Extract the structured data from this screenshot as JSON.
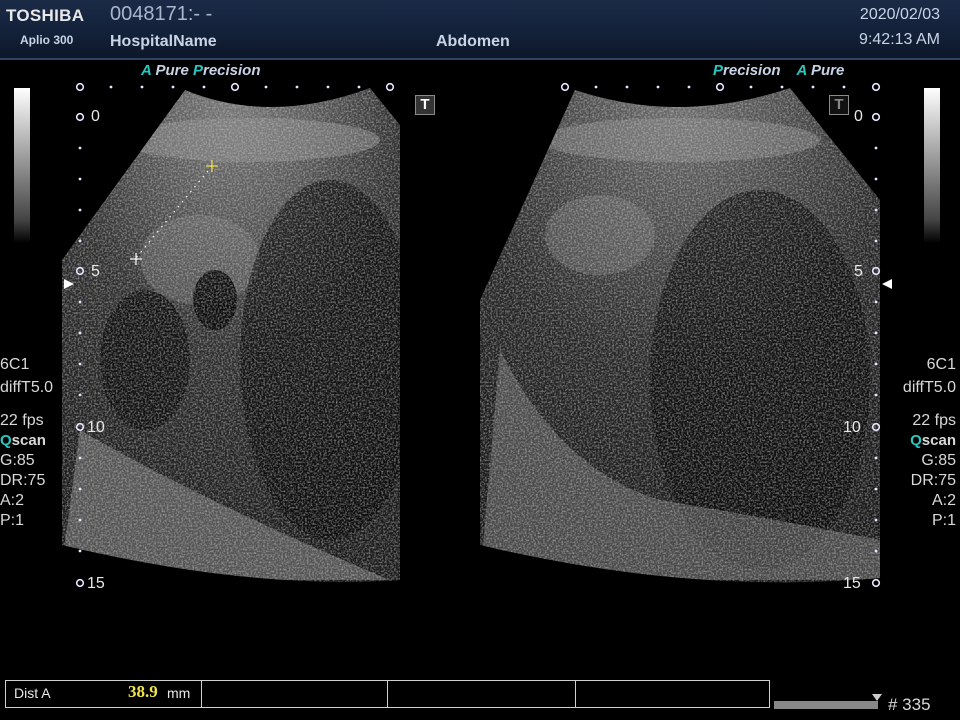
{
  "header": {
    "brand": "TOSHIBA",
    "model": "Aplio 300",
    "patient_id": "0048171:- -",
    "hospital": "HospitalName",
    "exam": "Abdomen",
    "date": "2020/02/03",
    "time": "9:42:13 AM"
  },
  "left_tag": {
    "a": "A",
    "pure": " Pure ",
    "p": "P",
    "recision": "recision"
  },
  "right_tag": {
    "p": "P",
    "recision": "recision",
    "a": "A",
    "pure": " Pure"
  },
  "depth_marks": [
    "0",
    "5",
    "10",
    "15"
  ],
  "params": {
    "probe": "6C1",
    "filter": "diffT5.0",
    "fps": "22 fps",
    "q": "Q",
    "scan": "scan",
    "gain": "G:85",
    "dr": "DR:75",
    "a": "A:2",
    "p": "P:1"
  },
  "t_marker": "T",
  "measurement": {
    "label": "Dist A",
    "value": "38.9",
    "unit": "mm",
    "value_color": "#f1e44a"
  },
  "frame": "# 335",
  "colors": {
    "header_bg": "#13213a",
    "accent": "#2ac7c0",
    "caliper": "#f1e44a"
  }
}
